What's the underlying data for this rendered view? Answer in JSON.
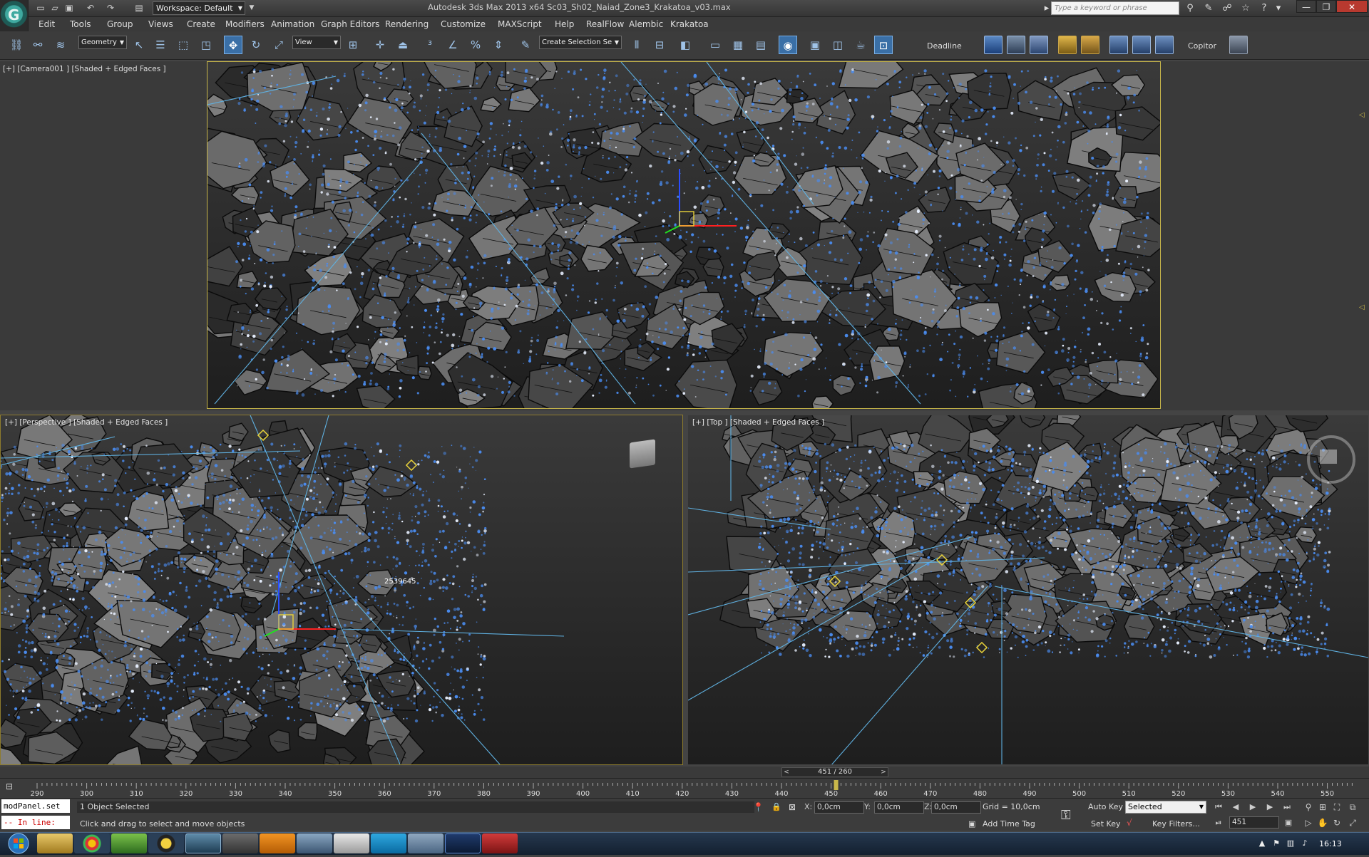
{
  "app": {
    "logo_letter": "G",
    "window_title": "Autodesk 3ds Max  2013 x64      Sc03_Sh02_Naiad_Zone3_Krakatoa_v03.max",
    "workspace": "Workspace: Default",
    "search_placeholder": "Type a keyword or phrase"
  },
  "menu": [
    "Edit",
    "Tools",
    "Group",
    "Views",
    "Create",
    "Modifiers",
    "Animation",
    "Graph Editors",
    "Rendering",
    "Customize",
    "MAXScript",
    "Help",
    "RealFlow",
    "Alembic",
    "Krakatoa"
  ],
  "toolbar": {
    "selection_filter": "Geometry",
    "reference_coord": "View",
    "named_selection": "Create Selection Se",
    "deadline_label": "Deadline",
    "copitor_label": "Copitor"
  },
  "viewports": {
    "camera": "[+] [Camera001 ] [Shaded + Edged Faces ]",
    "perspective": "[+] [Perspective ] [Shaded + Edged Faces ]",
    "top": "[+] [Top ] [Shaded + Edged Faces ]",
    "persp_readout": "2539645"
  },
  "timeline": {
    "frame_counter": "451 / 260",
    "ticks": [
      "290",
      "300",
      "310",
      "320",
      "330",
      "340",
      "350",
      "360",
      "370",
      "380",
      "390",
      "400",
      "410",
      "420",
      "430",
      "440",
      "450",
      "460",
      "470",
      "480",
      "490",
      "500",
      "510",
      "520",
      "530",
      "540",
      "550"
    ]
  },
  "status": {
    "maxscript_input": "modPanel.set",
    "maxscript_output": "-- In line:",
    "objects_selected": "1 Object Selected",
    "prompt_hint": "Click and drag to select and move objects",
    "x_label": "X:",
    "y_label": "Y:",
    "z_label": "Z:",
    "x_value": "0,0cm",
    "y_value": "0,0cm",
    "z_value": "0,0cm",
    "grid": "Grid = 10,0cm",
    "add_time_tag": "Add Time Tag",
    "auto_key": "Auto Key",
    "set_key": "Set Key",
    "key_mode": "Selected",
    "key_filters": "Key Filters...",
    "current_frame": "451"
  },
  "taskbar": {
    "clock": "16:13"
  },
  "colors": {
    "particle_blue": "#4a8cf0",
    "active_viewport_border": "#c9b74a",
    "helper_lines": "#5fb0e0",
    "selection_yellow": "#e8d23a"
  }
}
